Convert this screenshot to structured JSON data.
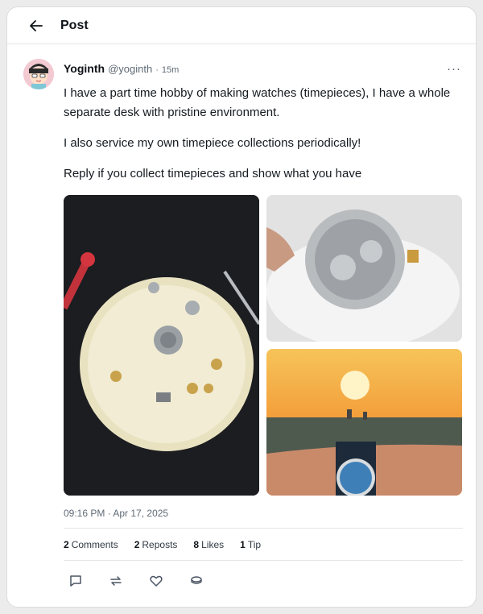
{
  "header": {
    "title": "Post"
  },
  "post": {
    "author_name": "Yoginth",
    "author_handle": "@yoginth",
    "separator": "·",
    "time_ago": "15m",
    "more_label": "···",
    "paragraphs": [
      "I have a part time hobby of making watches (timepieces), I have a whole separate desk with pristine environment.",
      "I also service my own timepiece collections periodically!",
      "Reply if you collect timepieces and show what you have"
    ],
    "timestamp": "09:16 PM · Apr 17, 2025",
    "stats": {
      "comments_count": "2",
      "comments_label": "Comments",
      "reposts_count": "2",
      "reposts_label": "Reposts",
      "likes_count": "8",
      "likes_label": "Likes",
      "tips_count": "1",
      "tips_label": "Tip"
    }
  },
  "icons": [
    "arrow-left-icon",
    "more-icon",
    "comment-icon",
    "repost-icon",
    "heart-icon",
    "tip-icon"
  ],
  "colors": {
    "text": "#0f1419",
    "muted": "#5f6b76",
    "divider": "#e6e6e6"
  }
}
